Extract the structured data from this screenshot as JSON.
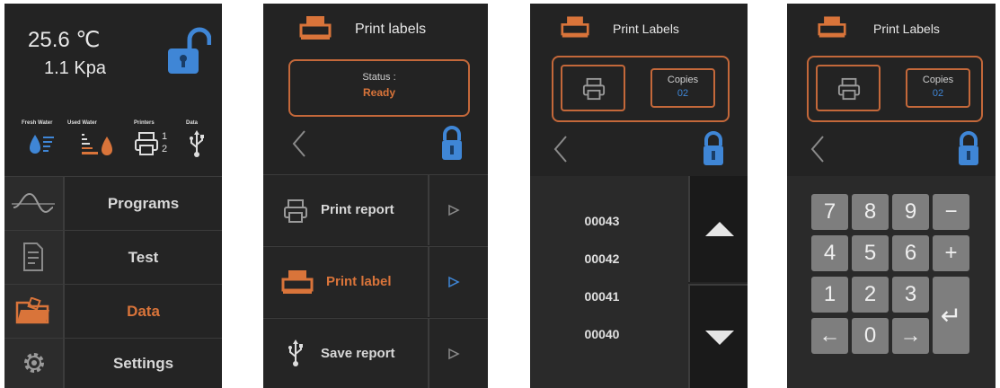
{
  "main_menu": {
    "temperature": "25.6 ℃",
    "pressure": "1.1 Kpa",
    "status_labels": {
      "fresh_water": "Fresh Water",
      "used_water": "Used Water",
      "printers": "Printers",
      "data": "Data"
    },
    "printer_numbers": [
      "1",
      "2"
    ],
    "items": [
      {
        "label": "Programs",
        "icon": "waveform-icon"
      },
      {
        "label": "Test",
        "icon": "document-icon"
      },
      {
        "label": "Data",
        "icon": "folder-icon",
        "active": true
      },
      {
        "label": "Settings",
        "icon": "gear-icon"
      }
    ]
  },
  "print_menu": {
    "title": "Print labels",
    "status_label": "Status :",
    "status_value": "Ready",
    "items": [
      {
        "label": "Print report",
        "icon": "printer-icon"
      },
      {
        "label": "Print label",
        "icon": "label-printer-icon",
        "active": true
      },
      {
        "label": "Save report",
        "icon": "usb-icon"
      }
    ]
  },
  "label_list": {
    "title": "Print Labels",
    "copies_label": "Copies",
    "copies_value": "02",
    "entries": [
      "00043",
      "00042",
      "00041",
      "00040"
    ]
  },
  "keypad_screen": {
    "title": "Print Labels",
    "copies_label": "Copies",
    "copies_value": "02",
    "keys": [
      "7",
      "8",
      "9",
      "−",
      "4",
      "5",
      "6",
      "+",
      "1",
      "2",
      "3",
      "←",
      "0",
      "→",
      "↵"
    ]
  },
  "colors": {
    "background": "#232323",
    "accent_orange": "#d9743a",
    "accent_blue": "#3f86d6",
    "key_gray": "#7e7e7e"
  }
}
